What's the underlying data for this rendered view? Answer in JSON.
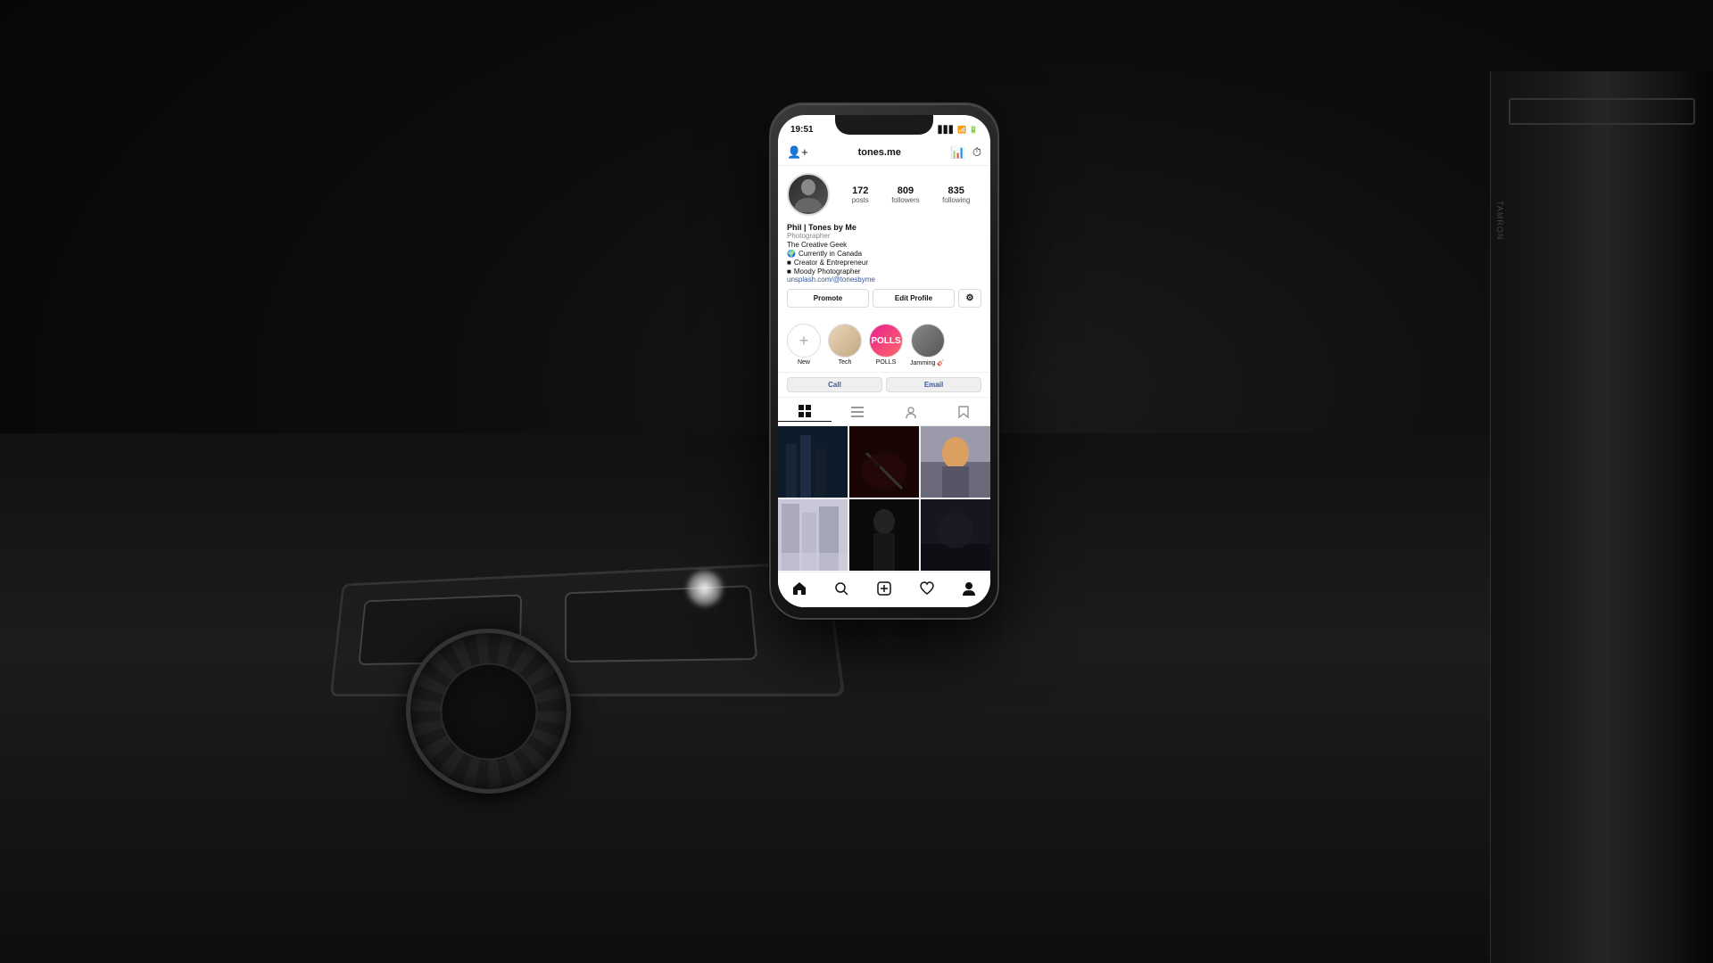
{
  "scene": {
    "background": "dark photography desk setup"
  },
  "phone": {
    "status_bar": {
      "time": "19:51",
      "icons": "signal bars, wifi, battery"
    },
    "app": "Instagram"
  },
  "instagram": {
    "top_nav": {
      "add_account_icon": "person-plus",
      "username": "tones.me",
      "stats_icon": "bar-chart",
      "history_icon": "clock"
    },
    "profile": {
      "stats": {
        "posts_count": "172",
        "posts_label": "posts",
        "followers_count": "809",
        "followers_label": "followers",
        "following_count": "835",
        "following_label": "following"
      },
      "buttons": {
        "promote": "Promote",
        "edit_profile": "Edit Profile"
      },
      "name": "Phil | Tones by Me",
      "title": "Photographer",
      "bio_lines": [
        "The Creative Geek",
        "🌍 Currently in Canada",
        "■ Creator & Entrepreneur",
        "■ Moody Photographer"
      ],
      "link": "unsplash.com/@tonesbyme"
    },
    "highlights": [
      {
        "label": "New",
        "type": "new"
      },
      {
        "label": "Tech",
        "type": "tech"
      },
      {
        "label": "POLLS",
        "type": "polls"
      },
      {
        "label": "Jamming 🎸",
        "type": "jamming"
      }
    ],
    "contact_buttons": {
      "call": "Call",
      "email": "Email"
    },
    "tabs": {
      "grid": "⊞",
      "list": "☰",
      "person": "👤",
      "bookmark": "🔖"
    },
    "grid_photos": [
      {
        "id": 1,
        "style": "dark-blue"
      },
      {
        "id": 2,
        "style": "dark-red"
      },
      {
        "id": 3,
        "style": "blond-person"
      },
      {
        "id": 4,
        "style": "architecture"
      },
      {
        "id": 5,
        "style": "dark-person"
      },
      {
        "id": 6,
        "style": "dark-moody"
      }
    ],
    "bottom_nav": {
      "home": "🏠",
      "search": "🔍",
      "add": "➕",
      "heart": "🤍",
      "profile": "👤"
    }
  }
}
